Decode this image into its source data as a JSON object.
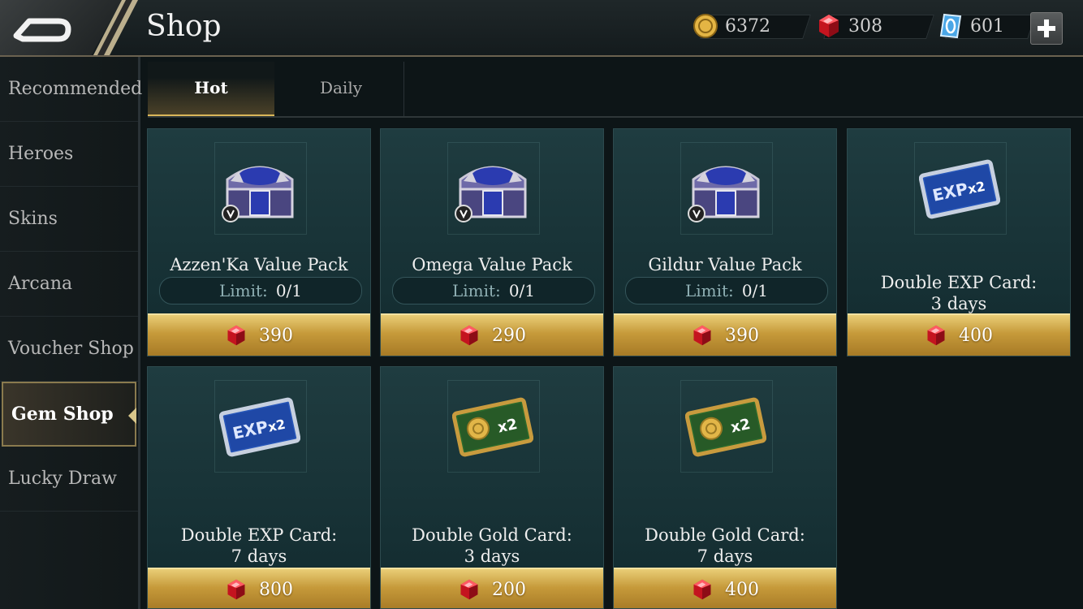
{
  "header": {
    "title": "Shop",
    "gold": "6372",
    "gems": "308",
    "vouchers": "601",
    "back_icon": "back-arrow-icon",
    "plus_icon": "plus-icon"
  },
  "sidebar": {
    "items": [
      {
        "label": "Recommended",
        "active": false
      },
      {
        "label": "Heroes",
        "active": false
      },
      {
        "label": "Skins",
        "active": false
      },
      {
        "label": "Arcana",
        "active": false
      },
      {
        "label": "Voucher Shop",
        "active": false
      },
      {
        "label": "Gem Shop",
        "active": true
      },
      {
        "label": "Lucky Draw",
        "active": false
      }
    ]
  },
  "tabs": [
    {
      "label": "Hot",
      "active": true
    },
    {
      "label": "Daily",
      "active": false
    }
  ],
  "products": [
    {
      "name": "Azzen'Ka Value Pack",
      "icon": "chest-icon",
      "limit_label": "Limit:",
      "limit": "0/1",
      "price": "390"
    },
    {
      "name": "Omega Value Pack",
      "icon": "chest-icon",
      "limit_label": "Limit:",
      "limit": "0/1",
      "price": "290"
    },
    {
      "name": "Gildur Value Pack",
      "icon": "chest-icon",
      "limit_label": "Limit:",
      "limit": "0/1",
      "price": "390"
    },
    {
      "name": "Double EXP Card:",
      "name2": "3 days",
      "icon": "exp-card-icon",
      "price": "400"
    },
    {
      "name": "Double EXP Card:",
      "name2": "7 days",
      "icon": "exp-card-icon",
      "price": "800"
    },
    {
      "name": "Double Gold Card:",
      "name2": "3 days",
      "icon": "gold-card-icon",
      "price": "200"
    },
    {
      "name": "Double Gold Card:",
      "name2": "7 days",
      "icon": "gold-card-icon",
      "price": "400"
    }
  ],
  "card_text": {
    "exp": "EXP",
    "x2": "x2"
  },
  "colors": {
    "gem": "#d81e2c",
    "gold_button": "#c69a3a",
    "card_bg": "#1f3c40"
  }
}
